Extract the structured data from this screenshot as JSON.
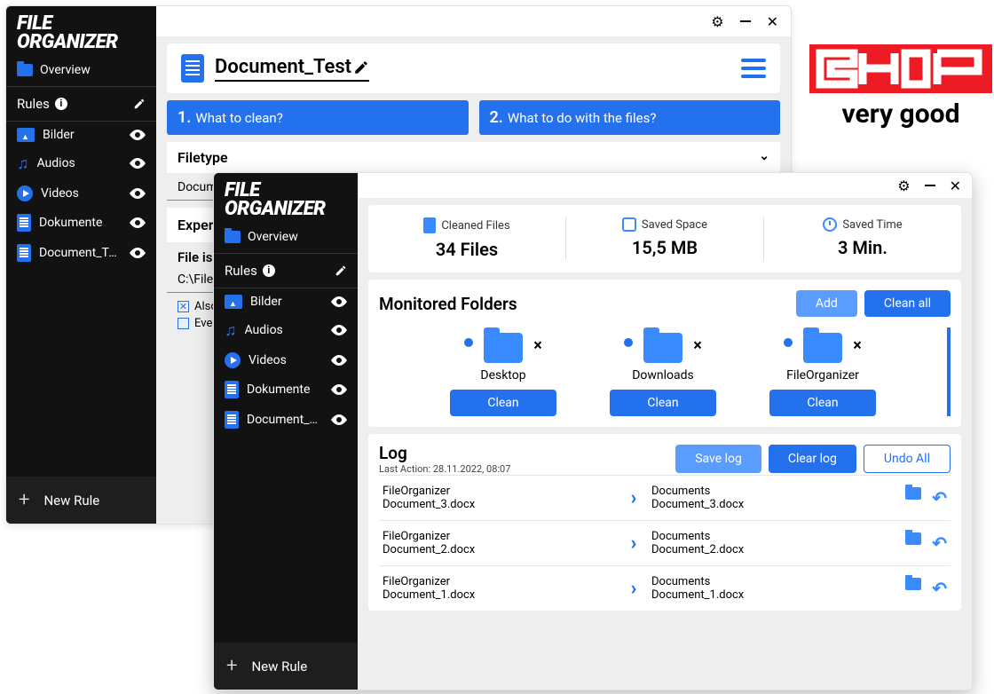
{
  "app_name_line1": "FILE",
  "app_name_line2": "ORGANIZER",
  "overview_label": "Overview",
  "rules_label": "Rules",
  "new_rule_label": "New Rule",
  "rule_items": [
    {
      "label": "Bilder",
      "icon": "bilder"
    },
    {
      "label": "Audios",
      "icon": "audio"
    },
    {
      "label": "Videos",
      "icon": "video"
    },
    {
      "label": "Dokumente",
      "icon": "doc"
    },
    {
      "label": "Document_Test",
      "icon": "doc"
    }
  ],
  "doc": {
    "name": "Document_Test",
    "step1": {
      "num": "1.",
      "label": "What to clean?"
    },
    "step2": {
      "num": "2.",
      "label": "What to do with the files?"
    },
    "filetype_label": "Filetype",
    "filetype_value": "Docume",
    "expert_label": "Expert",
    "file_is_label": "File is i",
    "path_value": "C:\\FileO",
    "chk1_label": "Also a",
    "chk2_label": "Even a"
  },
  "stats": {
    "cleaned_label": "Cleaned Files",
    "cleaned_value": "34 Files",
    "saved_space_label": "Saved Space",
    "saved_space_value": "15,5 MB",
    "saved_time_label": "Saved Time",
    "saved_time_value": "3 Min."
  },
  "monitored": {
    "title": "Monitored Folders",
    "add_btn": "Add",
    "clean_all_btn": "Clean all",
    "clean_btn": "Clean",
    "folders": [
      {
        "name": "Desktop"
      },
      {
        "name": "Downloads"
      },
      {
        "name": "FileOrganizer"
      }
    ]
  },
  "log": {
    "title": "Log",
    "subtitle": "Last Action: 28.11.2022, 08:07",
    "save_btn": "Save log",
    "clear_btn": "Clear log",
    "undo_btn": "Undo All",
    "rows": [
      {
        "from_a": "FileOrganizer",
        "from_b": "Document_3.docx",
        "to_a": "Documents",
        "to_b": "Document_3.docx"
      },
      {
        "from_a": "FileOrganizer",
        "from_b": "Document_2.docx",
        "to_a": "Documents",
        "to_b": "Document_2.docx"
      },
      {
        "from_a": "FileOrganizer",
        "from_b": "Document_1.docx",
        "to_a": "Documents",
        "to_b": "Document_1.docx"
      }
    ]
  },
  "chip": {
    "brand": "CHIP",
    "rating": "very good"
  }
}
